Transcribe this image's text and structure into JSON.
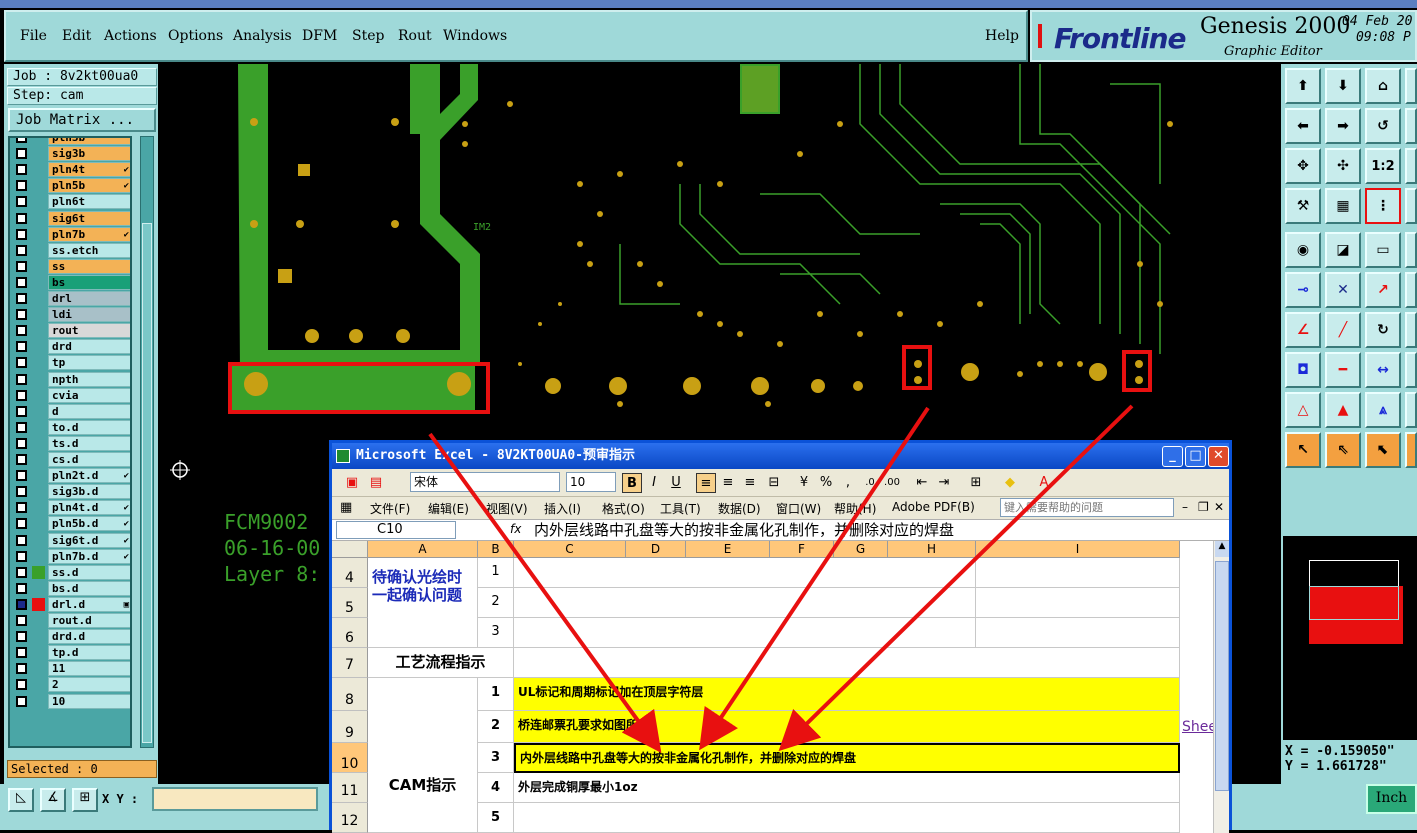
{
  "menubar": {
    "items": [
      "File",
      "Edit",
      "Actions",
      "Options",
      "Analysis",
      "DFM",
      "Step",
      "Rout",
      "Windows"
    ],
    "help": "Help"
  },
  "brand": {
    "logo": "Frontline",
    "product": "Genesis 2000",
    "subtitle": "Graphic Editor",
    "date": "04 Feb 20",
    "time": "09:08 P"
  },
  "job": {
    "job_label": "Job : 8v2kt00ua0",
    "step_label": "Step: cam",
    "matrix_button": "Job Matrix ..."
  },
  "layers": [
    {
      "name": "pln3b",
      "color": "#f3b256",
      "mark": ""
    },
    {
      "name": "sig3b",
      "color": "#f3b256",
      "mark": ""
    },
    {
      "name": "pln4t",
      "color": "#f3b256",
      "mark": "✔"
    },
    {
      "name": "pln5b",
      "color": "#f3b256",
      "mark": "✔"
    },
    {
      "name": "pln6t",
      "color": "#b9e8e8",
      "mark": ""
    },
    {
      "name": "sig6t",
      "color": "#f3b256",
      "mark": ""
    },
    {
      "name": "pln7b",
      "color": "#f3b256",
      "mark": "✔"
    },
    {
      "name": "ss.etch",
      "color": "#b9e8e8",
      "mark": ""
    },
    {
      "name": "ss",
      "color": "#f3b256",
      "mark": ""
    },
    {
      "name": "bs",
      "color": "#1aa078",
      "mark": ""
    },
    {
      "name": "drl",
      "color": "#a8c0c8",
      "mark": ""
    },
    {
      "name": "ldi",
      "color": "#a8c0c8",
      "mark": ""
    },
    {
      "name": "rout",
      "color": "#d8d8d8",
      "mark": ""
    },
    {
      "name": "drd",
      "color": "#b9e8e8",
      "mark": ""
    },
    {
      "name": "tp",
      "color": "#b9e8e8",
      "mark": ""
    },
    {
      "name": "npth",
      "color": "#b9e8e8",
      "mark": ""
    },
    {
      "name": "cvia",
      "color": "#b9e8e8",
      "mark": ""
    },
    {
      "name": "d",
      "color": "#b9e8e8",
      "mark": ""
    },
    {
      "name": "to.d",
      "color": "#b9e8e8",
      "mark": ""
    },
    {
      "name": "ts.d",
      "color": "#b9e8e8",
      "mark": ""
    },
    {
      "name": "cs.d",
      "color": "#b9e8e8",
      "mark": ""
    },
    {
      "name": "pln2t.d",
      "color": "#b9e8e8",
      "mark": "✔"
    },
    {
      "name": "sig3b.d",
      "color": "#b9e8e8",
      "mark": ""
    },
    {
      "name": "pln4t.d",
      "color": "#b9e8e8",
      "mark": "✔"
    },
    {
      "name": "pln5b.d",
      "color": "#b9e8e8",
      "mark": "✔"
    },
    {
      "name": "sig6t.d",
      "color": "#b9e8e8",
      "mark": "✔"
    },
    {
      "name": "pln7b.d",
      "color": "#b9e8e8",
      "mark": "✔"
    },
    {
      "name": "ss.d",
      "color": "#b9e8e8",
      "mark": "",
      "ind": "#3aa02a"
    },
    {
      "name": "bs.d",
      "color": "#b9e8e8",
      "mark": ""
    },
    {
      "name": "drl.d",
      "color": "#b9e8e8",
      "mark": "▣",
      "ind": "#e81010",
      "cb": "#1b2a8a"
    },
    {
      "name": "rout.d",
      "color": "#b9e8e8",
      "mark": ""
    },
    {
      "name": "drd.d",
      "color": "#b9e8e8",
      "mark": ""
    },
    {
      "name": "tp.d",
      "color": "#b9e8e8",
      "mark": ""
    },
    {
      "name": "11",
      "color": "#b9e8e8",
      "mark": ""
    },
    {
      "name": "2",
      "color": "#b9e8e8",
      "mark": ""
    },
    {
      "name": "10",
      "color": "#b9e8e8",
      "mark": ""
    }
  ],
  "selected_label": "Selected : 0",
  "status": {
    "xy_label": "X Y :",
    "xy_value": "",
    "unit_button": "Inch"
  },
  "coords": {
    "x": "X = -0.159050\"",
    "y": "Y =  1.661728\""
  },
  "pcb_text": {
    "line1": "FCM9002",
    "line2": "06-16-00",
    "line3": "Layer 8:",
    "silk": "IM2"
  },
  "colors": {
    "copper": "#3aa02a",
    "pad": "#c8a014",
    "annotation": "#e81010",
    "panel": "#9fd9d9",
    "layer_orange": "#f3b256"
  },
  "excel": {
    "title": "Microsoft Excel - 8V2KT00UA0-预审指示",
    "font_name": "宋体",
    "font_size": "10",
    "menu": [
      "文件(F)",
      "编辑(E)",
      "视图(V)",
      "插入(I)",
      "格式(O)",
      "工具(T)",
      "数据(D)",
      "窗口(W)",
      "帮助(H)",
      "Adobe PDF(B)"
    ],
    "help_placeholder": "键入需要帮助的问题",
    "name_box": "C10",
    "fx": "fx",
    "formula": "内外层线路中孔盘等大的按非金属化孔制作，并删除对应的焊盘",
    "col_headers": [
      "A",
      "B",
      "C",
      "D",
      "E",
      "F",
      "G",
      "H",
      "I"
    ],
    "rows": [
      "4",
      "5",
      "6",
      "7",
      "8",
      "9",
      "10",
      "11",
      "12"
    ],
    "confirm_label": "待确认光绘时一起确认问题",
    "confirm_nums": [
      "1",
      "2",
      "3"
    ],
    "process_label": "工艺流程指示",
    "cam_label": "CAM指示",
    "cam_items": [
      {
        "num": "1",
        "text": "UL标记和周期标记加在顶层字符层"
      },
      {
        "num": "2",
        "text": "桥连邮票孔要求如图所示"
      },
      {
        "num": "3",
        "text": "内外层线路中孔盘等大的按非金属化孔制作，并删除对应的焊盘"
      },
      {
        "num": "4",
        "text": "外层完成铜厚最小1oz"
      },
      {
        "num": "5",
        "text": ""
      }
    ],
    "sheet_link": "Shee"
  }
}
